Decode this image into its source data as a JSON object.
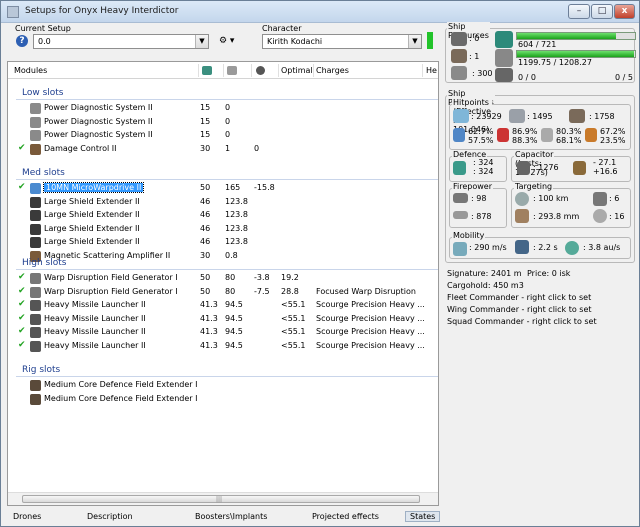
{
  "window": {
    "title": "Setups for Onyx Heavy Interdictor",
    "buttons": [
      "–",
      "□",
      "x"
    ]
  },
  "setup": {
    "label": "Current Setup",
    "value": "0.0"
  },
  "character": {
    "label": "Character",
    "value": "Kirith Kodachi"
  },
  "icons": {
    "help": "?",
    "tool": "⚙ ▾",
    "dropdown": "▼",
    "check": "✔"
  },
  "columns": {
    "modules": "Modules",
    "optimal": "Optimal",
    "charges": "Charges",
    "he": "He"
  },
  "groups": {
    "low": "Low slots",
    "med": "Med slots",
    "high": "High slots",
    "rig": "Rig slots"
  },
  "low": [
    {
      "check": "",
      "name": "Power Diagnostic System II",
      "c1": "15",
      "c2": "0",
      "c3": "",
      "opt": "",
      "chg": ""
    },
    {
      "check": "",
      "name": "Power Diagnostic System II",
      "c1": "15",
      "c2": "0",
      "c3": "",
      "opt": "",
      "chg": ""
    },
    {
      "check": "",
      "name": "Power Diagnostic System II",
      "c1": "15",
      "c2": "0",
      "c3": "",
      "opt": "",
      "chg": ""
    },
    {
      "check": "✔",
      "name": "Damage Control II",
      "c1": "30",
      "c2": "1",
      "c3": "0",
      "opt": "",
      "chg": ""
    }
  ],
  "med": [
    {
      "check": "✔",
      "name": "10MN MicroWarpdrive II",
      "c1": "50",
      "c2": "165",
      "c3": "-15.8",
      "opt": "",
      "chg": ""
    },
    {
      "check": "",
      "name": "Large Shield Extender II",
      "c1": "46",
      "c2": "123.8",
      "c3": "",
      "opt": "",
      "chg": ""
    },
    {
      "check": "",
      "name": "Large Shield Extender II",
      "c1": "46",
      "c2": "123.8",
      "c3": "",
      "opt": "",
      "chg": ""
    },
    {
      "check": "",
      "name": "Large Shield Extender II",
      "c1": "46",
      "c2": "123.8",
      "c3": "",
      "opt": "",
      "chg": ""
    },
    {
      "check": "",
      "name": "Large Shield Extender II",
      "c1": "46",
      "c2": "123.8",
      "c3": "",
      "opt": "",
      "chg": ""
    },
    {
      "check": "",
      "name": "Magnetic Scattering Amplifier II",
      "c1": "30",
      "c2": "0.8",
      "c3": "",
      "opt": "",
      "chg": ""
    }
  ],
  "high": [
    {
      "check": "✔",
      "name": "Warp Disruption Field Generator I",
      "c1": "50",
      "c2": "80",
      "c3": "-3.8",
      "opt": "19.2",
      "chg": ""
    },
    {
      "check": "✔",
      "name": "Warp Disruption Field Generator I",
      "c1": "50",
      "c2": "80",
      "c3": "-7.5",
      "opt": "28.8",
      "chg": "Focused Warp Disruption"
    },
    {
      "check": "✔",
      "name": "Heavy Missile Launcher II",
      "c1": "41.3",
      "c2": "94.5",
      "c3": "",
      "opt": "<55.1",
      "chg": "Scourge Precision Heavy ..."
    },
    {
      "check": "✔",
      "name": "Heavy Missile Launcher II",
      "c1": "41.3",
      "c2": "94.5",
      "c3": "",
      "opt": "<55.1",
      "chg": "Scourge Precision Heavy ..."
    },
    {
      "check": "✔",
      "name": "Heavy Missile Launcher II",
      "c1": "41.3",
      "c2": "94.5",
      "c3": "",
      "opt": "<55.1",
      "chg": "Scourge Precision Heavy ..."
    },
    {
      "check": "✔",
      "name": "Heavy Missile Launcher II",
      "c1": "41.3",
      "c2": "94.5",
      "c3": "",
      "opt": "<55.1",
      "chg": "Scourge Precision Heavy ..."
    }
  ],
  "rig": [
    {
      "check": "",
      "name": "Medium Core Defence Field Extender I",
      "c1": "",
      "c2": "",
      "c3": "",
      "opt": "",
      "chg": ""
    },
    {
      "check": "",
      "name": "Medium Core Defence Field Extender I",
      "c1": "",
      "c2": "",
      "c3": "",
      "opt": "",
      "chg": ""
    }
  ],
  "bottom_tabs": [
    "Drones",
    "Description",
    "Boosters\\Implants",
    "Projected effects",
    "States"
  ],
  "resources": {
    "label": "Ship Resources",
    "turrets": ": 0",
    "launchers": ": 1",
    "calibration": ": 300",
    "cpu": "604 / 721",
    "cpu_fill": 0.84,
    "power": "1199.75 / 1208.27",
    "power_fill": 0.99,
    "drones_used": "0 / 0",
    "drones_slots": "0 / 5"
  },
  "params": {
    "label": "Ship Parameters",
    "hp": {
      "label": "Hitpoints (Effective HP: 101,046)",
      "shield": ": 23929",
      "armor": ": 1495",
      "structure": ": 1758",
      "resist": [
        [
          "62.7%",
          "57.5%"
        ],
        [
          "86.9%",
          "88.3%"
        ],
        [
          "80.3%",
          "68.1%"
        ],
        [
          "67.2%",
          "23.5%"
        ]
      ]
    },
    "defence": {
      "label": "Defence",
      "a": ": 324",
      "b": ": 324"
    },
    "capacitor": {
      "label": "Capacitor (Lasts: 1m 27s)",
      "cap": ": 1276",
      "d1": "- 27.1",
      "d2": "+16.6"
    },
    "firepower": {
      "label": "Firepower",
      "dps": ": 98",
      "volley": ": 878"
    },
    "targeting": {
      "label": "Targeting",
      "range": ": 100 km",
      "scanres": ": 293.8 mm",
      "targets": ": 6",
      "sensor": ": 16"
    },
    "mobility": {
      "label": "Mobility",
      "speed": ": 290 m/s",
      "align": ": 2.2 s",
      "warp": ": 3.8 au/s"
    }
  },
  "info": {
    "signature": "Signature: 2401 m",
    "price": "Price: 0 isk",
    "cargohold": "Cargohold: 450 m3",
    "fleet": "Fleet Commander - right click to set",
    "wing": "Wing Commander - right click to set",
    "squad": "Squad Commander - right click to set"
  },
  "colors": {
    "accent_green": "#22c32a",
    "selection": "#3399ff",
    "group_blue": "#1f3f8f"
  }
}
